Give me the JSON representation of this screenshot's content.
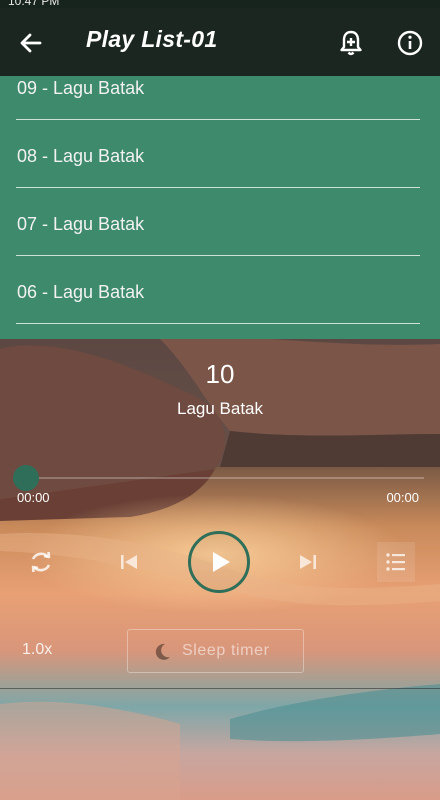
{
  "status_bar": {
    "time": "10:47 PM",
    "extra": ""
  },
  "app_bar": {
    "title": "Play List-01",
    "back_icon": "arrow-left-icon",
    "add_alarm_icon": "bell-plus-icon",
    "info_icon": "info-icon"
  },
  "playlist": {
    "items": [
      {
        "label": "09 - Lagu Batak"
      },
      {
        "label": "08 - Lagu Batak"
      },
      {
        "label": "07 - Lagu Batak"
      },
      {
        "label": "06 - Lagu Batak"
      }
    ]
  },
  "player": {
    "track_number": "10",
    "track_name": "Lagu Batak",
    "progress": 0,
    "time_elapsed": "00:00",
    "time_total": "00:00",
    "speed": "1.0x",
    "sleep_timer_label": "Sleep timer",
    "accent_color": "#2f6f5a",
    "icons": [
      "repeat-icon",
      "skip-previous-icon",
      "play-icon",
      "skip-next-icon",
      "queue-list-icon",
      "moon-icon"
    ]
  },
  "colors": {
    "app_bar": "#1b2620",
    "playlist_bg": "#3e8a6c"
  }
}
